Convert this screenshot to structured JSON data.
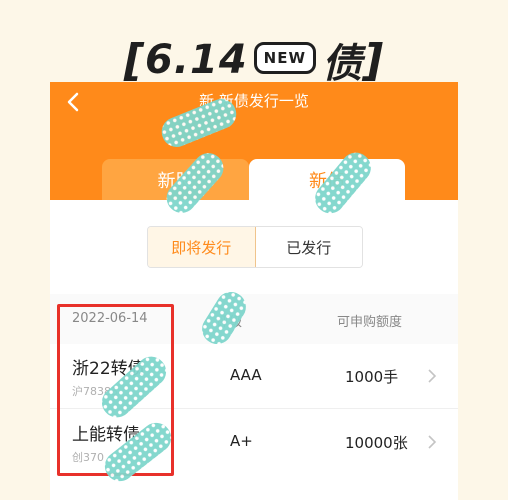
{
  "headline": {
    "open": "[",
    "part1": "6.14",
    "badge": "NEW",
    "part2": "债",
    "close": "]"
  },
  "nav": {
    "title": "新 新债发行一览"
  },
  "tabs": [
    {
      "label": "新股"
    },
    {
      "label": "新债"
    }
  ],
  "segmented": {
    "active": "即将发行",
    "inactive": "已发行"
  },
  "list_header": {
    "date": "2022-06-14",
    "rating": "评级",
    "quota": "可申购额度"
  },
  "rows": [
    {
      "name": "浙22转债",
      "code": "沪78383",
      "rating": "AAA",
      "quota": "1000手"
    },
    {
      "name": "上能转债",
      "code": "创370",
      "rating": "A+",
      "quota": "10000张"
    }
  ],
  "colors": {
    "brand": "#ff8a1a",
    "highlight": "#e8312a",
    "sticker": "#7fd6cc"
  }
}
